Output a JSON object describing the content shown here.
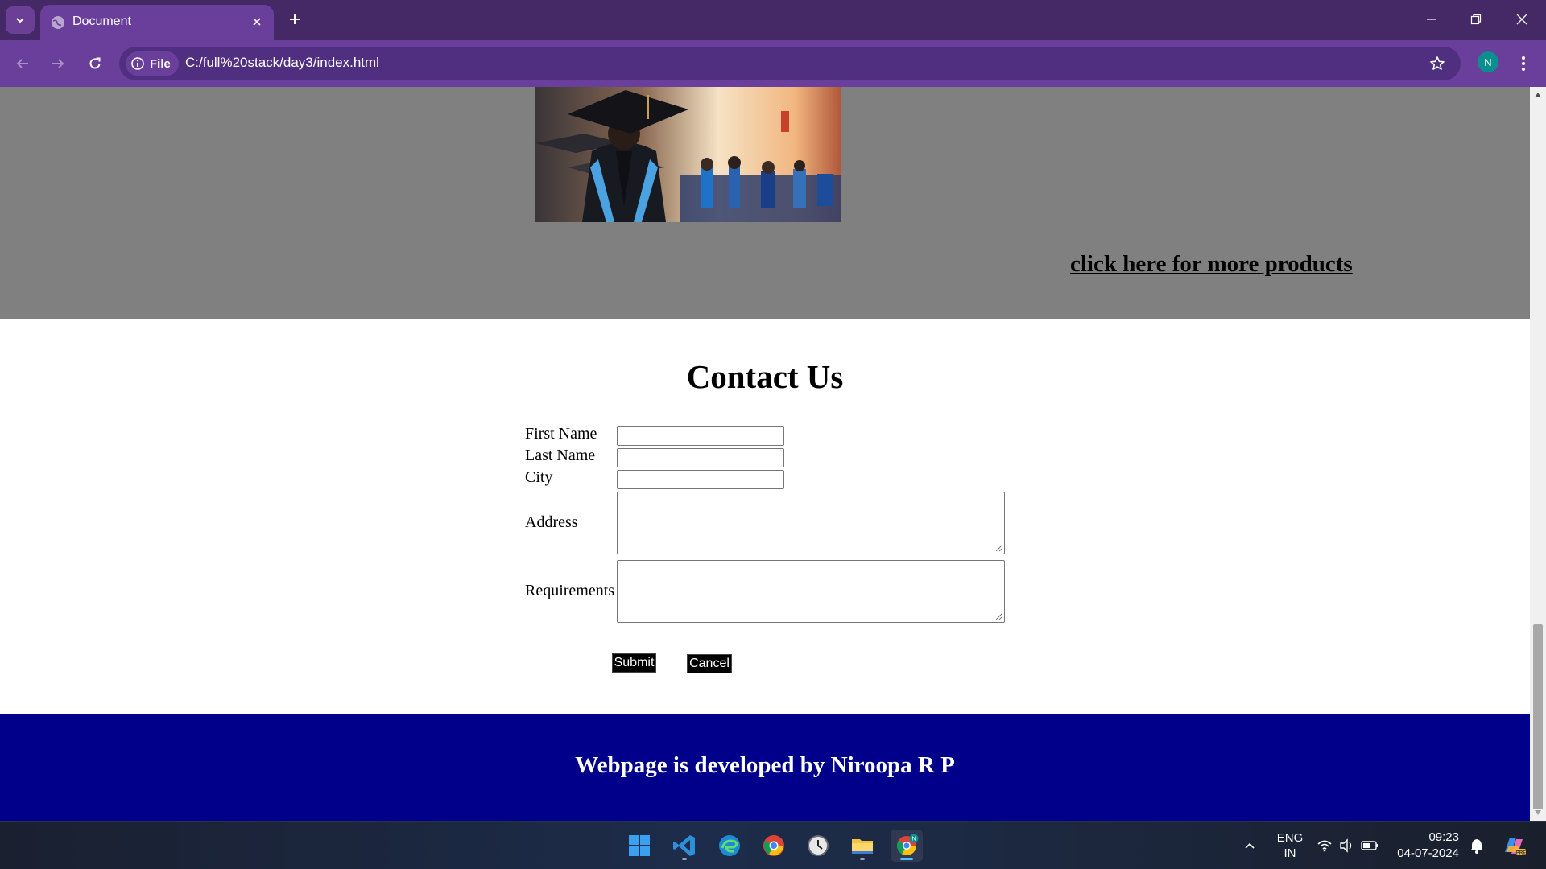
{
  "browser": {
    "tab_title": "Document",
    "site_chip": "File",
    "url": "C:/full%20stack/day3/index.html",
    "profile_initial": "N"
  },
  "page": {
    "more_products_link": "click here for more products",
    "contact_title": "Contact Us",
    "labels": {
      "first_name": "First Name",
      "last_name": "Last Name",
      "city": "City",
      "address": "Address",
      "requirements": "Requirements"
    },
    "fields": {
      "first_name": "",
      "last_name": "",
      "city": "",
      "address": "",
      "requirements": ""
    },
    "submit_label": "Submit",
    "cancel_label": "Cancel",
    "footer_text": "Webpage is developed by Niroopa R P",
    "image_alt": "graduates in caps and gowns"
  },
  "taskbar": {
    "lang_line1": "ENG",
    "lang_line2": "IN",
    "time": "09:23",
    "date": "04-07-2024",
    "apps": [
      "start-icon",
      "vscode-icon",
      "edge-icon",
      "chrome-icon",
      "clock-app-icon",
      "file-explorer-icon",
      "chrome-profile-icon"
    ]
  },
  "colors": {
    "tabbar": "#442966",
    "toolbar": "#6a3f9c",
    "products_bg": "#808080",
    "footer_bg": "#00008b"
  }
}
